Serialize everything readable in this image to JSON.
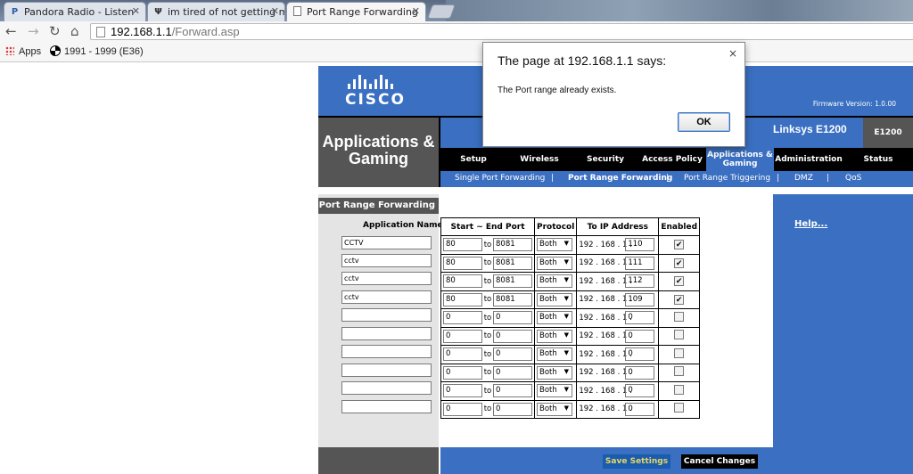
{
  "browser": {
    "tabs": [
      {
        "label": "Pandora Radio - Listen",
        "favicon": "P"
      },
      {
        "label": "im tired of not getting mi",
        "favicon": "Ψ"
      },
      {
        "label": "Port Range Forwarding",
        "favicon": ""
      }
    ],
    "url_host": "192.168.1.1",
    "url_path": "/Forward.asp",
    "bookmarks": [
      {
        "label": "Apps",
        "icon": "apps-grid-icon"
      },
      {
        "label": "1991 - 1999 (E36)",
        "icon": "bmw-logo-icon"
      }
    ]
  },
  "router": {
    "brand": "CISCO",
    "firmware": "Firmware Version: 1.0.00",
    "section_title": "Applications & Gaming",
    "model_name": "Linksys E1200",
    "model_code": "E1200",
    "nav": [
      "Setup",
      "Wireless",
      "Security",
      "Access Policy",
      "Applications & Gaming",
      "Administration",
      "Status"
    ],
    "nav_selected": 4,
    "subnav": [
      "Single Port Forwarding",
      "Port Range Forwarding",
      "Port Range Triggering",
      "DMZ",
      "QoS"
    ],
    "subnav_selected": 1,
    "page_section": "Port Range Forwarding",
    "help_link": "Help...",
    "table": {
      "app_name_header": "Application Name",
      "headers": [
        "Start ~ End Port",
        "Protocol",
        "To IP Address",
        "Enabled"
      ],
      "to_label": "to",
      "ip_prefix": "192 . 168 . 1 .",
      "rows": [
        {
          "name": "CCTV",
          "start": "80",
          "end": "8081",
          "protocol": "Both",
          "ip": "110",
          "enabled": true
        },
        {
          "name": "cctv",
          "start": "80",
          "end": "8081",
          "protocol": "Both",
          "ip": "111",
          "enabled": true
        },
        {
          "name": "cctv",
          "start": "80",
          "end": "8081",
          "protocol": "Both",
          "ip": "112",
          "enabled": true
        },
        {
          "name": "cctv",
          "start": "80",
          "end": "8081",
          "protocol": "Both",
          "ip": "109",
          "enabled": true
        },
        {
          "name": "",
          "start": "0",
          "end": "0",
          "protocol": "Both",
          "ip": "0",
          "enabled": false
        },
        {
          "name": "",
          "start": "0",
          "end": "0",
          "protocol": "Both",
          "ip": "0",
          "enabled": false
        },
        {
          "name": "",
          "start": "0",
          "end": "0",
          "protocol": "Both",
          "ip": "0",
          "enabled": false
        },
        {
          "name": "",
          "start": "0",
          "end": "0",
          "protocol": "Both",
          "ip": "0",
          "enabled": false
        },
        {
          "name": "",
          "start": "0",
          "end": "0",
          "protocol": "Both",
          "ip": "0",
          "enabled": false
        },
        {
          "name": "",
          "start": "0",
          "end": "0",
          "protocol": "Both",
          "ip": "0",
          "enabled": false
        }
      ]
    },
    "buttons": {
      "save": "Save Settings",
      "cancel": "Cancel Changes"
    },
    "colors": {
      "blue": "#3a6fc1",
      "gray": "#555555",
      "save_text": "#e9d660"
    }
  },
  "dialog": {
    "title": "The page at 192.168.1.1 says:",
    "message": "The Port range already exists.",
    "ok": "OK",
    "close": "×"
  }
}
